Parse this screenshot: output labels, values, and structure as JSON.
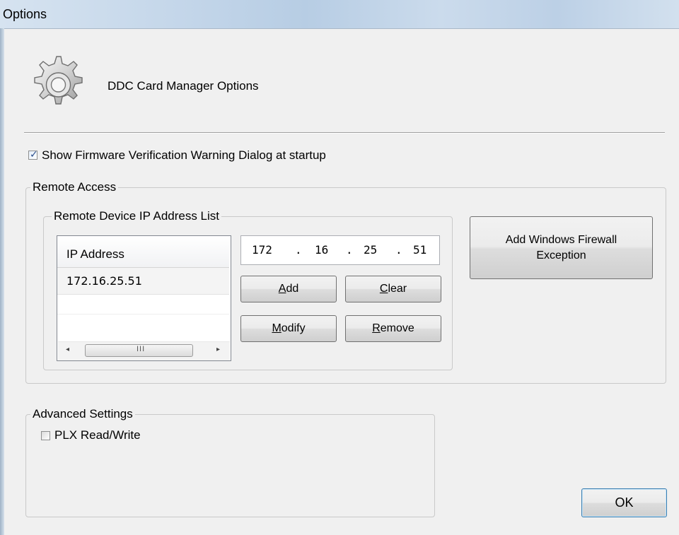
{
  "window": {
    "title": "Options"
  },
  "header": {
    "text": "DDC Card Manager Options",
    "icon": "gear-icon"
  },
  "firmware_warning": {
    "label": "Show Firmware Verification Warning Dialog at startup",
    "checked": true
  },
  "remote_access": {
    "title": "Remote Access",
    "ip_list_group": {
      "title": "Remote Device IP Address List",
      "column_header": "IP Address",
      "rows": [
        "172.16.25.51"
      ]
    },
    "ip_input": {
      "octets": [
        "172",
        "16",
        "25",
        "51"
      ],
      "separator": "."
    },
    "buttons": {
      "add": {
        "mnemonic": "A",
        "rest": "dd"
      },
      "clear": {
        "mnemonic": "C",
        "rest": "lear"
      },
      "modify": {
        "mnemonic": "M",
        "rest": "odify"
      },
      "remove": {
        "mnemonic": "R",
        "rest": "emove"
      }
    },
    "firewall_button": {
      "line1": "Add Windows Firewall",
      "line2": "Exception"
    }
  },
  "advanced": {
    "title": "Advanced Settings",
    "plx": {
      "label": "PLX Read/Write",
      "checked": false
    }
  },
  "ok_button": "OK",
  "scrollbar": {
    "left_arrow": "◂",
    "right_arrow": "▸",
    "grip": "III"
  }
}
